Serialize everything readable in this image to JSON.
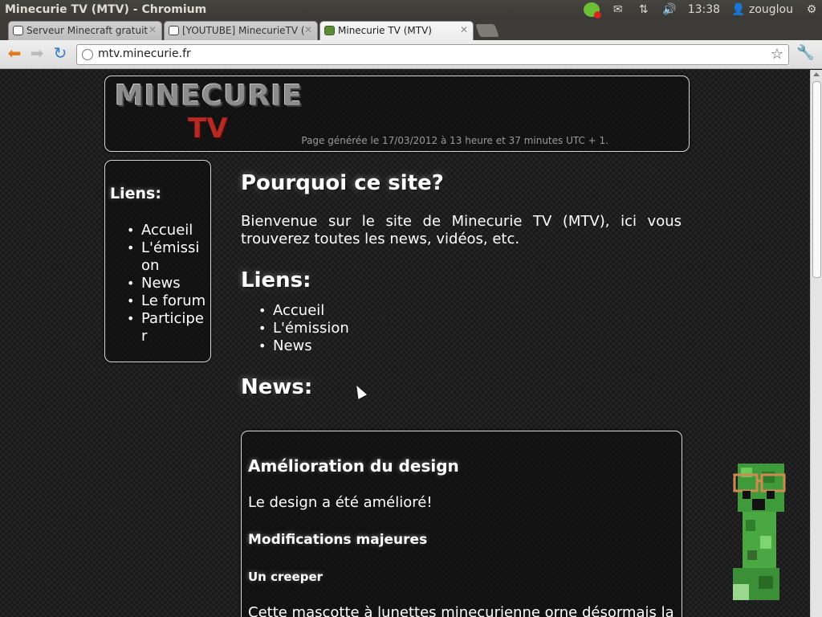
{
  "window": {
    "title": "Minecurie TV (MTV) - Chromium"
  },
  "tray": {
    "time": "13:38",
    "user": "zouglou"
  },
  "tabs": [
    {
      "label": "Serveur Minecraft gratuit"
    },
    {
      "label": "[YOUTUBE] MinecurieTV ("
    },
    {
      "label": "Minecurie TV (MTV)"
    }
  ],
  "toolbar": {
    "url": "mtv.minecurie.fr"
  },
  "header": {
    "logo_main": "MINECURIE",
    "logo_tv": "TV",
    "generated": "Page générée le 17/03/2012 à 13 heure et 37 minutes UTC + 1."
  },
  "sidebar": {
    "title": "Liens:",
    "items": [
      "Accueil",
      "L'émission",
      "News",
      "Le forum",
      "Participer"
    ]
  },
  "content": {
    "title": "Pourquoi ce site?",
    "intro": "Bienvenue sur le site de Minecurie TV (MTV), ici vous trouverez toutes les news, vidéos, etc.",
    "links_title": "Liens:",
    "links": [
      "Accueil",
      "L'émission",
      "News"
    ],
    "news_title": "News:"
  },
  "news": {
    "title": "Amélioration du design",
    "text": "Le design a été amélioré!",
    "subtitle": "Modifications majeures",
    "subsubtitle": "Un creeper",
    "body": "Cette mascotte à lunettes minecurienne orne désormais la"
  }
}
